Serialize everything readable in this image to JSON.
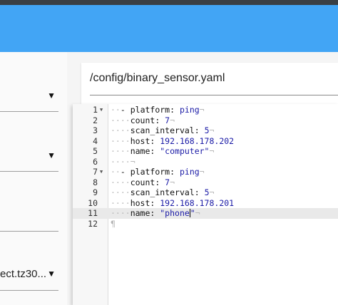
{
  "left_panel": {
    "items": [
      {
        "text": ""
      },
      {
        "text": ""
      },
      {
        "text": ""
      },
      {
        "text": "ect.tz30..."
      }
    ]
  },
  "file": {
    "path": "/config/binary_sensor.yaml"
  },
  "editor": {
    "lines": [
      {
        "n": "1",
        "fold": "▼",
        "ws": "··",
        "dash": "- ",
        "key": "platform:",
        "sep": " ",
        "val": "ping",
        "eol": "¬"
      },
      {
        "n": "2",
        "fold": "",
        "ws": "····",
        "dash": "",
        "key": "count:",
        "sep": " ",
        "val": "7",
        "eol": "¬"
      },
      {
        "n": "3",
        "fold": "",
        "ws": "····",
        "dash": "",
        "key": "scan_interval:",
        "sep": " ",
        "val": "5",
        "eol": "¬"
      },
      {
        "n": "4",
        "fold": "",
        "ws": "····",
        "dash": "",
        "key": "host:",
        "sep": " ",
        "val": "192.168.178.202",
        "eol": ""
      },
      {
        "n": "5",
        "fold": "",
        "ws": "····",
        "dash": "",
        "key": "name:",
        "sep": " ",
        "val": "\"computer\"",
        "eol": "¬"
      },
      {
        "n": "6",
        "fold": "",
        "ws": "····¬",
        "dash": "",
        "key": "",
        "sep": "",
        "val": "",
        "eol": ""
      },
      {
        "n": "7",
        "fold": "▼",
        "ws": "··",
        "dash": "- ",
        "key": "platform:",
        "sep": " ",
        "val": "ping",
        "eol": "¬"
      },
      {
        "n": "8",
        "fold": "",
        "ws": "····",
        "dash": "",
        "key": "count:",
        "sep": " ",
        "val": "7",
        "eol": "¬"
      },
      {
        "n": "9",
        "fold": "",
        "ws": "····",
        "dash": "",
        "key": "scan_interval:",
        "sep": " ",
        "val": "5",
        "eol": "¬"
      },
      {
        "n": "10",
        "fold": "",
        "ws": "····",
        "dash": "",
        "key": "host:",
        "sep": " ",
        "val": "192.168.178.201",
        "eol": ""
      },
      {
        "n": "11",
        "fold": "",
        "ws": "····",
        "dash": "",
        "key": "name:",
        "sep": " ",
        "val": "\"phone\"",
        "eol": "¬",
        "active": true,
        "cursor": true
      },
      {
        "n": "12",
        "fold": "",
        "ws": "¶",
        "dash": "",
        "key": "",
        "sep": "",
        "val": "",
        "eol": ""
      }
    ]
  },
  "colors": {
    "header": "#42a5f5",
    "topbar": "#3a3f44",
    "active_line": "#e9e9e9"
  }
}
